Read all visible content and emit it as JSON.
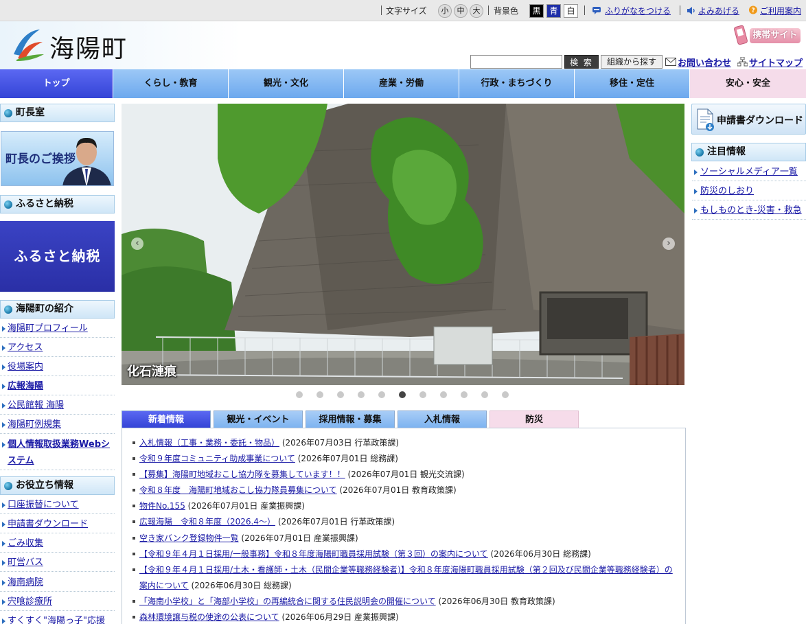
{
  "util": {
    "font_size_label": "文字サイズ",
    "font_sizes": [
      "小",
      "中",
      "大"
    ],
    "bg_color_label": "背景色",
    "bg_options": [
      "黒",
      "青",
      "白"
    ],
    "furigana": "ふりがなをつける",
    "read_aloud": "よみあげる",
    "help": "ご利用案内"
  },
  "header": {
    "logo_text": "海陽町",
    "mobile_site": "携帯サイト",
    "search_placeholder": "",
    "search_button": "検 索",
    "org_search": "組織から探す",
    "contact": "お問い合わせ",
    "sitemap": "サイトマップ"
  },
  "gnav": [
    "トップ",
    "くらし・教育",
    "観光・文化",
    "産業・労働",
    "行政・まちづくり",
    "移住・定住",
    "安心・安全"
  ],
  "left": {
    "mayor_heading": "町長室",
    "mayor_banner": "町長のご挨拶",
    "furusato_heading": "ふるさと納税",
    "furusato_banner": "ふるさと納税",
    "intro_heading": "海陽町の紹介",
    "intro_links": [
      "海陽町プロフィール",
      "アクセス",
      "役場案内",
      "広報海陽",
      "公民館報 海陽",
      "海陽町例規集",
      "個人情報取扱業務Webシステム"
    ],
    "useful_heading": "お役立ち情報",
    "useful_links": [
      "口座振替について",
      "申請書ダウンロード",
      "ごみ収集",
      "町営バス",
      "海南病院",
      "宍喰診療所",
      "すくすく\"海陽っ子\"応援"
    ]
  },
  "slide": {
    "caption": "化石漣痕",
    "dot_count": 11,
    "active_dot": 6
  },
  "tabs": [
    "新着情報",
    "観光・イベント",
    "採用情報・募集",
    "入札情報",
    "防災"
  ],
  "news": [
    {
      "title": "入札情報（工事・業務・委託・物品）",
      "meta": " (2026年07月03日 行革政策課)"
    },
    {
      "title": "令和９年度コミュニティ助成事業について",
      "meta": " (2026年07月01日 総務課)"
    },
    {
      "title": "【募集】海陽町地域おこし協力隊を募集しています！！",
      "meta": " (2026年07月01日 観光交流課)"
    },
    {
      "title": "令和８年度　海陽町地域おこし協力隊員募集について",
      "meta": " (2026年07月01日 教育政策課)"
    },
    {
      "title": "物件No.155",
      "meta": " (2026年07月01日 産業振興課)"
    },
    {
      "title": "広報海陽　令和８年度（2026.4〜）",
      "meta": " (2026年07月01日 行革政策課)"
    },
    {
      "title": "空き家バンク登録物件一覧",
      "meta": " (2026年07月01日 産業振興課)"
    },
    {
      "title": "【令和９年４月１日採用/一般事務】令和８年度海陽町職員採用試験（第３回）の案内について",
      "meta": " (2026年06月30日 総務課)"
    },
    {
      "title": "【令和９年４月１日採用/土木・看護師・土木（民間企業等職務経験者)】令和８年度海陽町職員採用試験（第２回及び民間企業等職務経験者）の案内について",
      "meta": " (2026年06月30日 総務課)"
    },
    {
      "title": "「海南小学校」と「海部小学校」の再編統合に関する住民説明会の開催について",
      "meta": " (2026年06月30日 教育政策課)"
    },
    {
      "title": "森林環境譲与税の使途の公表について",
      "meta": " (2026年06月29日 産業振興課)"
    }
  ],
  "right": {
    "download": "申請書ダウンロード",
    "featured_heading": "注目情報",
    "featured_links": [
      "ソーシャルメディア一覧",
      "防災のしおり",
      "もしものとき-災害・救急"
    ]
  }
}
